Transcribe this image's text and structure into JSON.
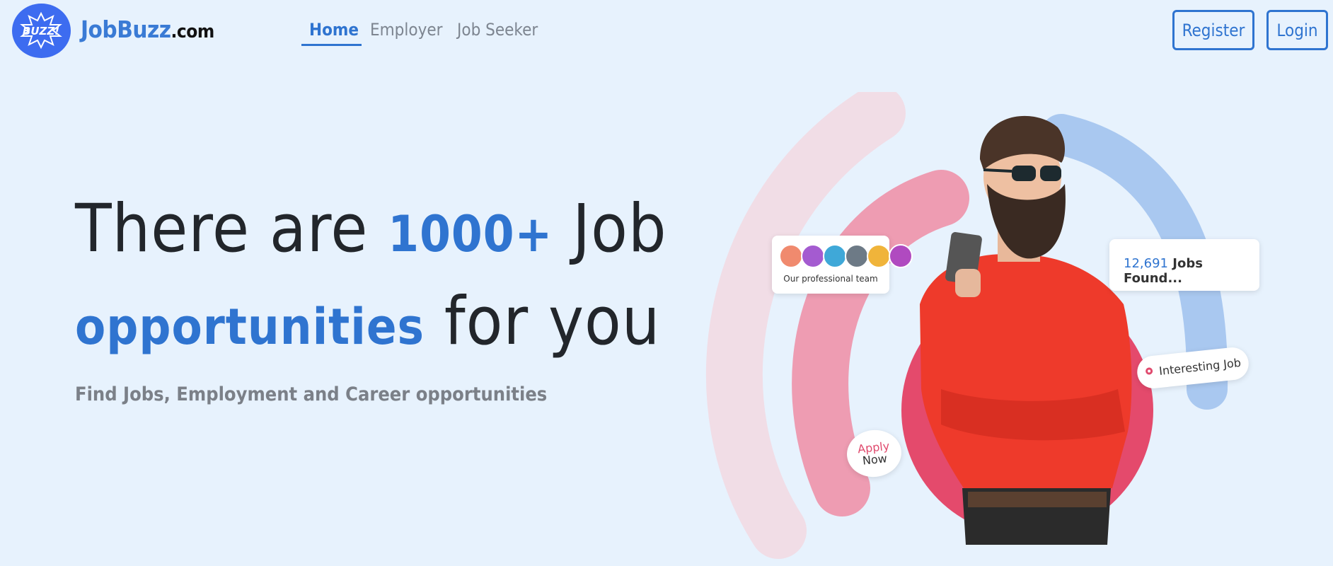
{
  "brand": {
    "name_main": "JobBuzz",
    "name_suffix": ".com",
    "logo_text": "BUZZ!"
  },
  "nav": {
    "links": [
      {
        "label": "Home",
        "active": true
      },
      {
        "label": "Employer",
        "active": false
      },
      {
        "label": "Job Seeker",
        "active": false
      }
    ],
    "register_label": "Register",
    "login_label": "Login"
  },
  "hero": {
    "line1_a": "There are ",
    "line1_highlight": "1000+",
    "line1_b": " Job",
    "line2_highlight": "opportunities",
    "line2_b": " for you",
    "subtitle": "Find Jobs, Employment and Career opportunities"
  },
  "illustration": {
    "team_label": "Our professional team",
    "jobs_count": "12,691",
    "jobs_label": " Jobs Found...",
    "interesting_label": "Interesting Job",
    "apply_line1": "Apply",
    "apply_line2": "Now"
  },
  "colors": {
    "accent": "#2f74d0",
    "logo_bg": "#3d6cf0",
    "pink": "#e04b6e",
    "background": "#e7f2fd"
  }
}
